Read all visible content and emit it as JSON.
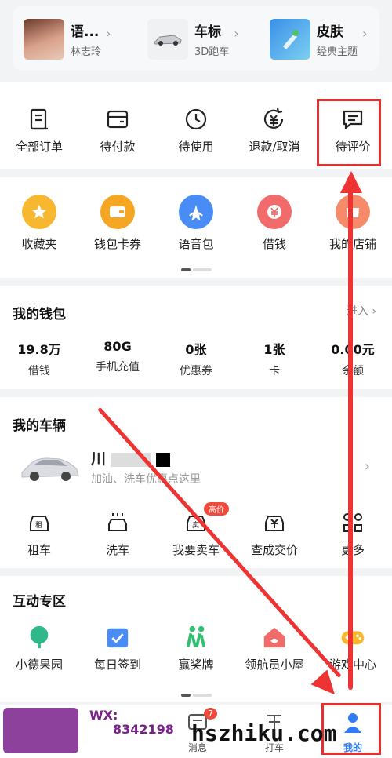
{
  "quick": {
    "avatar": {
      "title": "语...",
      "sub": "林志玲"
    },
    "car_logo": {
      "title": "车标",
      "sub": "3D跑车"
    },
    "skin": {
      "title": "皮肤",
      "sub": "经典主题"
    }
  },
  "orders": [
    {
      "label": "全部订单",
      "icon": "order-list-icon"
    },
    {
      "label": "待付款",
      "icon": "wallet-card-icon"
    },
    {
      "label": "待使用",
      "icon": "clock-icon"
    },
    {
      "label": "退款/取消",
      "icon": "refund-icon"
    },
    {
      "label": "待评价",
      "icon": "comment-icon"
    }
  ],
  "services": [
    {
      "label": "收藏夹",
      "color": "#f7b731"
    },
    {
      "label": "钱包卡券",
      "color": "#f5a623"
    },
    {
      "label": "语音包",
      "color": "#4a8cf6"
    },
    {
      "label": "借钱",
      "color": "#f26b6b"
    },
    {
      "label": "我的店铺",
      "color": "#f58b6b"
    }
  ],
  "wallet": {
    "title": "我的钱包",
    "enter": "进入",
    "items": [
      {
        "value": "19.8万",
        "label": "借钱"
      },
      {
        "value": "80G",
        "label": "手机充值"
      },
      {
        "value": "0张",
        "label": "优惠券"
      },
      {
        "value": "1张",
        "label": "卡"
      },
      {
        "value": "0.00元",
        "label": "余额"
      }
    ]
  },
  "vehicle": {
    "title": "我的车辆",
    "plate": "川",
    "hint": "加油、洗车优惠点这里",
    "actions": [
      {
        "label": "租车",
        "icon": "rent-car-icon"
      },
      {
        "label": "洗车",
        "icon": "car-wash-icon"
      },
      {
        "label": "我要卖车",
        "icon": "sell-car-icon",
        "badge": "高价"
      },
      {
        "label": "查成交价",
        "icon": "price-check-icon"
      },
      {
        "label": "更多",
        "icon": "grid-more-icon"
      }
    ]
  },
  "interact": {
    "title": "互动专区",
    "items": [
      {
        "label": "小德果园",
        "color": "#2fb98a"
      },
      {
        "label": "每日签到",
        "color": "#4a8cf6"
      },
      {
        "label": "赢奖牌",
        "color": "#2fc16f"
      },
      {
        "label": "领航员小屋",
        "color": "#f26b6b"
      },
      {
        "label": "游戏中心",
        "color": "#f7b731"
      }
    ]
  },
  "tabbar": {
    "messages": {
      "label": "消息",
      "badge": "7"
    },
    "taxi": {
      "label": "打车"
    },
    "mine": {
      "label": "我的"
    }
  },
  "watermark": {
    "wx": "WX:",
    "id": "8342198",
    "site": "hszhiku.com"
  }
}
